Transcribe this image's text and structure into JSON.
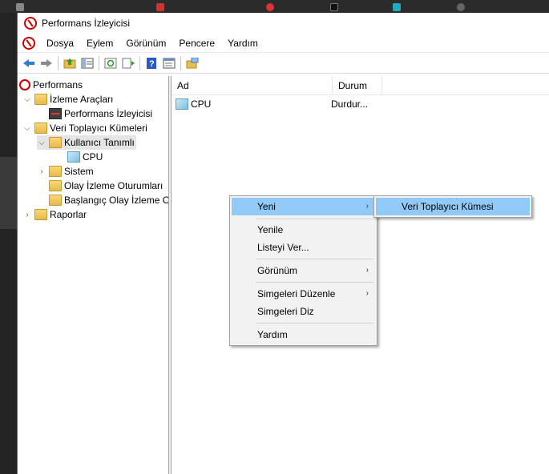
{
  "window": {
    "title": "Performans İzleyicisi"
  },
  "menubar": {
    "items": [
      "Dosya",
      "Eylem",
      "Görünüm",
      "Pencere",
      "Yardım"
    ]
  },
  "toolbar": {
    "buttons": [
      "back-icon",
      "forward-icon",
      "up-folder-icon",
      "show-hide-tree-icon",
      "refresh-icon",
      "export-icon",
      "help-icon",
      "properties-icon",
      "new-window-icon"
    ]
  },
  "tree": {
    "root": "Performans",
    "monitoring_tools": "İzleme Araçları",
    "perf_monitor": "Performans İzleyicisi",
    "data_collector_sets": "Veri Toplayıcı Kümeleri",
    "user_defined": "Kullanıcı Tanımlı",
    "cpu": "CPU",
    "system": "Sistem",
    "event_trace": "Olay İzleme Oturumları",
    "startup_trace": "Başlangıç Olay İzleme O",
    "reports": "Raporlar"
  },
  "list": {
    "columns": [
      "Ad",
      "Durum"
    ],
    "rows": [
      {
        "name": "CPU",
        "status": "Durdur..."
      }
    ]
  },
  "context_menu": {
    "items": [
      "Yeni",
      "Yenile",
      "Listeyi Ver...",
      "Görünüm",
      "Simgeleri Düzenle",
      "Simgeleri Diz",
      "Yardım"
    ],
    "submenu_arrow": "›"
  },
  "submenu": {
    "item": "Veri Toplayıcı Kümesi"
  },
  "colors": {
    "highlight": "#91c9f7",
    "menu_bg": "#f2f2f2",
    "selection": "#e5e5e5"
  }
}
